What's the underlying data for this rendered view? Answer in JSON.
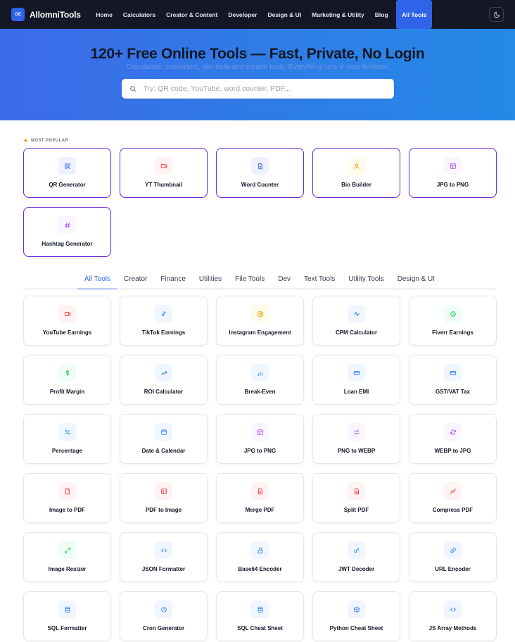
{
  "nav": {
    "logo_text": "OE",
    "brand": "AllomniTools",
    "links": [
      "Home",
      "Calculators",
      "Creator & Content",
      "Developer",
      "Design & UI",
      "Marketing & Utility",
      "Blog",
      "All Tools"
    ],
    "active_link": "All Tools",
    "theme_icon": "moon-icon"
  },
  "hero": {
    "title": "120+ Free Online Tools — Fast, Private, No Login",
    "subtitle": "Calculators, converters, dev tools and creator tools. Everything runs in your browser.",
    "search_placeholder": "Try: QR code, YouTube, word counter, PDF..."
  },
  "popular": {
    "heading": "MOST POPULAR",
    "items": [
      {
        "label": "QR Generator",
        "icon": "qr-icon",
        "color": "#4f6ef7",
        "bg": "#eef2ff"
      },
      {
        "label": "YT Thumbnail",
        "icon": "video-icon",
        "color": "#ef4444",
        "bg": "#fef2f2"
      },
      {
        "label": "Word Counter",
        "icon": "document-icon",
        "color": "#4f6ef7",
        "bg": "#eef2ff"
      },
      {
        "label": "Bio Builder",
        "icon": "user-icon",
        "color": "#f59e0b",
        "bg": "#fffbeb"
      },
      {
        "label": "JPG to PNG",
        "icon": "image-icon",
        "color": "#a855f7",
        "bg": "#faf5ff"
      },
      {
        "label": "Hashtag Generator",
        "icon": "hash-icon",
        "color": "#a855f7",
        "bg": "#faf5ff"
      }
    ]
  },
  "tabs": [
    "All Tools",
    "Creator",
    "Finance",
    "Utilities",
    "File Tools",
    "Dev",
    "Text Tools",
    "Utility Tools",
    "Design & UI"
  ],
  "active_tab": "All Tools",
  "tools": [
    {
      "label": "YouTube Earnings",
      "icon": "video-icon",
      "color": "#ef4444",
      "bg": "#fef2f2"
    },
    {
      "label": "TikTok Earnings",
      "icon": "music-note-icon",
      "color": "#3b82f6",
      "bg": "#eff6ff"
    },
    {
      "label": "Instagram Engagement",
      "icon": "camera-icon",
      "color": "#f59e0b",
      "bg": "#fffbeb"
    },
    {
      "label": "CPM Calculator",
      "icon": "activity-icon",
      "color": "#3b82f6",
      "bg": "#eff6ff"
    },
    {
      "label": "Fiverr Earnings",
      "icon": "clock-icon",
      "color": "#22c55e",
      "bg": "#f0fdf4"
    },
    {
      "label": "Profit Margin",
      "icon": "dollar-icon",
      "color": "#22c55e",
      "bg": "#f0fdf4"
    },
    {
      "label": "ROI Calculator",
      "icon": "trending-up-icon",
      "color": "#3b82f6",
      "bg": "#eff6ff"
    },
    {
      "label": "Break-Even",
      "icon": "bar-chart-icon",
      "color": "#3b82f6",
      "bg": "#eff6ff"
    },
    {
      "label": "Loan EMI",
      "icon": "credit-card-icon",
      "color": "#3b82f6",
      "bg": "#eff6ff"
    },
    {
      "label": "GST/VAT Tax",
      "icon": "credit-card-icon",
      "color": "#3b82f6",
      "bg": "#eff6ff"
    },
    {
      "label": "Percentage",
      "icon": "percent-icon",
      "color": "#3b82f6",
      "bg": "#eff6ff"
    },
    {
      "label": "Date & Calendar",
      "icon": "calendar-icon",
      "color": "#3b82f6",
      "bg": "#eff6ff"
    },
    {
      "label": "JPG to PNG",
      "icon": "image-icon",
      "color": "#a855f7",
      "bg": "#faf5ff"
    },
    {
      "label": "PNG to WEBP",
      "icon": "swap-icon",
      "color": "#a855f7",
      "bg": "#faf5ff"
    },
    {
      "label": "WEBP to JPG",
      "icon": "refresh-icon",
      "color": "#a855f7",
      "bg": "#faf5ff"
    },
    {
      "label": "Image to PDF",
      "icon": "file-icon",
      "color": "#ef4444",
      "bg": "#fef2f2"
    },
    {
      "label": "PDF to Image",
      "icon": "image-icon",
      "color": "#ef4444",
      "bg": "#fef2f2"
    },
    {
      "label": "Merge PDF",
      "icon": "file-plus-icon",
      "color": "#ef4444",
      "bg": "#fef2f2"
    },
    {
      "label": "Split PDF",
      "icon": "file-split-icon",
      "color": "#ef4444",
      "bg": "#fef2f2"
    },
    {
      "label": "Compress PDF",
      "icon": "minimize-icon",
      "color": "#ef4444",
      "bg": "#fef2f2"
    },
    {
      "label": "Image Resizer",
      "icon": "maximize-icon",
      "color": "#22c55e",
      "bg": "#f0fdf4"
    },
    {
      "label": "JSON Formatter",
      "icon": "code-icon",
      "color": "#3b82f6",
      "bg": "#eff6ff"
    },
    {
      "label": "Base64 Encoder",
      "icon": "lock-icon",
      "color": "#3b82f6",
      "bg": "#eff6ff"
    },
    {
      "label": "JWT Decoder",
      "icon": "key-icon",
      "color": "#3b82f6",
      "bg": "#eff6ff"
    },
    {
      "label": "URL Encoder",
      "icon": "link-icon",
      "color": "#3b82f6",
      "bg": "#eff6ff"
    },
    {
      "label": "SQL Formatter",
      "icon": "database-icon",
      "color": "#3b82f6",
      "bg": "#eff6ff"
    },
    {
      "label": "Cron Generator",
      "icon": "clock-icon",
      "color": "#3b82f6",
      "bg": "#eff6ff"
    },
    {
      "label": "SQL Cheat Sheet",
      "icon": "database-icon",
      "color": "#3b82f6",
      "bg": "#eff6ff"
    },
    {
      "label": "Python Cheat Sheet",
      "icon": "box-icon",
      "color": "#3b82f6",
      "bg": "#eff6ff"
    },
    {
      "label": "JS Array Methods",
      "icon": "code-icon",
      "color": "#3b82f6",
      "bg": "#eff6ff"
    }
  ]
}
